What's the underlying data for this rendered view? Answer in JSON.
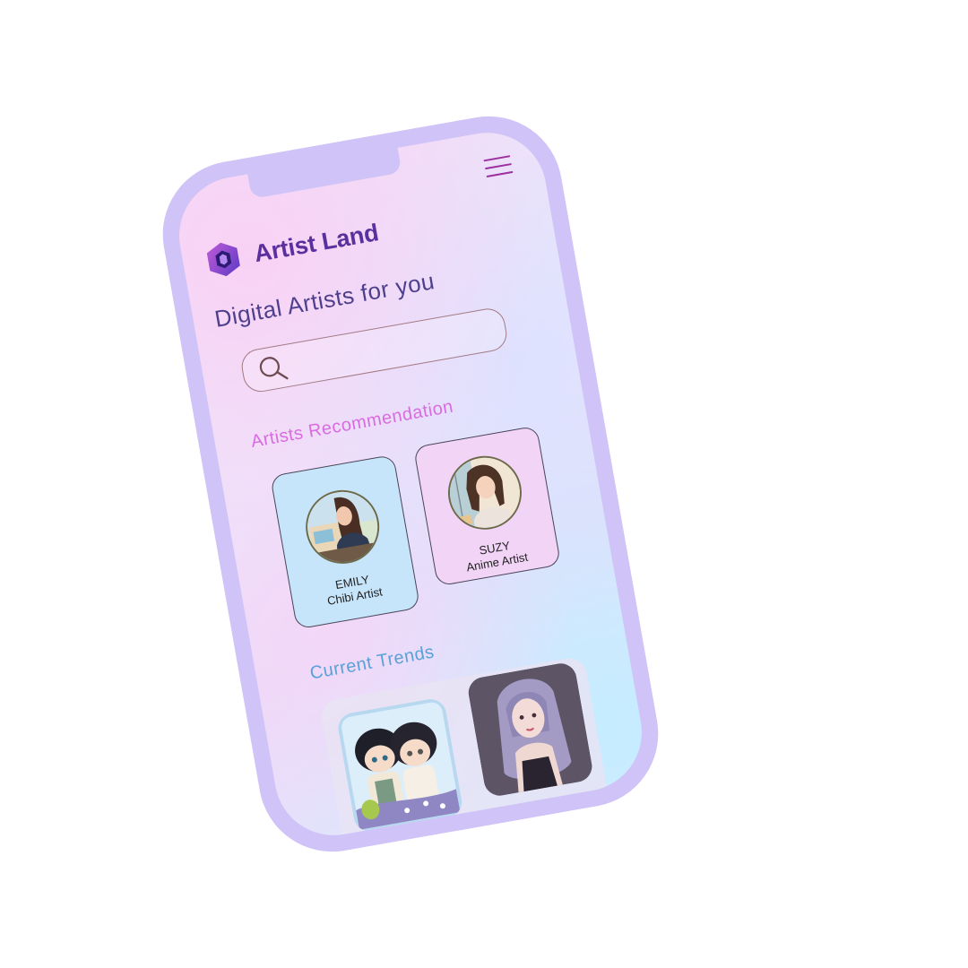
{
  "app": {
    "name": "Artist Land",
    "headline": "Digital Artists for you"
  },
  "search": {
    "placeholder": "",
    "icon": "search-icon"
  },
  "sections": {
    "recommendation_title": "Artists Recommendation",
    "trends_title": "Current Trends"
  },
  "artists": [
    {
      "name": "EMILY",
      "role": "Chibi Artist"
    },
    {
      "name": "SUZY",
      "role": "Anime Artist"
    }
  ],
  "colors": {
    "device_frame": "#cfc3f7",
    "brand_text": "#5a2f9e",
    "headline_text": "#4d3f8c",
    "recommendation_title": "#d86ce0",
    "trends_title": "#5aa1d8",
    "card_blue": "#c7e5fa",
    "card_pink": "#f2d4f7",
    "menu_icon": "#9b2f9f"
  },
  "icons": {
    "menu": "hamburger-menu-icon",
    "logo": "artist-land-logo"
  }
}
